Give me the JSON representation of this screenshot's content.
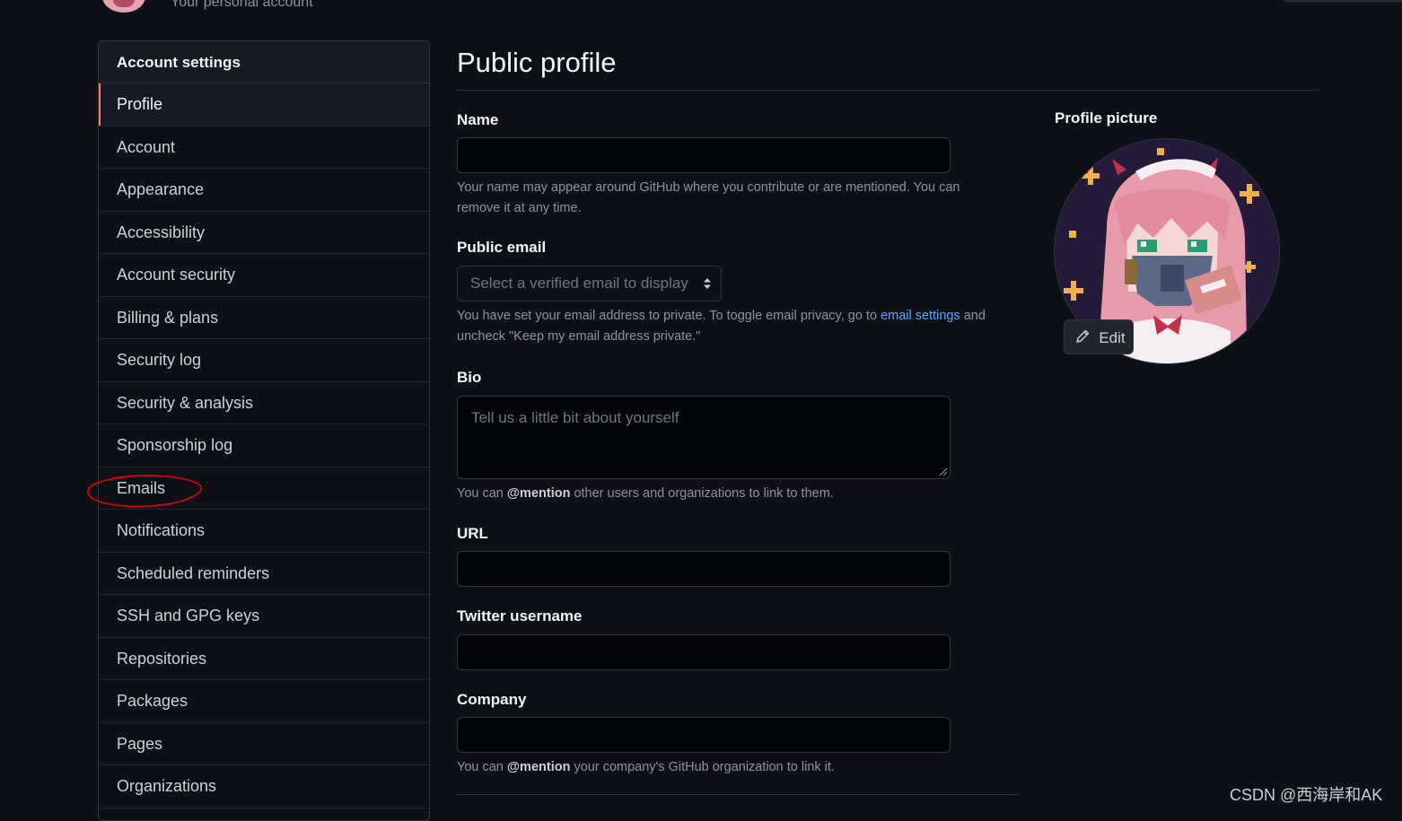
{
  "header": {
    "subtitle": "Your personal account"
  },
  "sidebar": {
    "title": "Account settings",
    "items": [
      {
        "label": "Profile",
        "selected": true
      },
      {
        "label": "Account"
      },
      {
        "label": "Appearance"
      },
      {
        "label": "Accessibility"
      },
      {
        "label": "Account security"
      },
      {
        "label": "Billing & plans"
      },
      {
        "label": "Security log"
      },
      {
        "label": "Security & analysis"
      },
      {
        "label": "Sponsorship log"
      },
      {
        "label": "Emails",
        "annotated": true
      },
      {
        "label": "Notifications"
      },
      {
        "label": "Scheduled reminders"
      },
      {
        "label": "SSH and GPG keys"
      },
      {
        "label": "Repositories"
      },
      {
        "label": "Packages"
      },
      {
        "label": "Pages"
      },
      {
        "label": "Organizations"
      }
    ]
  },
  "main": {
    "title": "Public profile",
    "name": {
      "label": "Name",
      "value": "",
      "note": "Your name may appear around GitHub where you contribute or are mentioned. You can remove it at any time."
    },
    "public_email": {
      "label": "Public email",
      "placeholder": "Select a verified email to display",
      "note_before": "You have set your email address to private. To toggle email privacy, go to ",
      "note_link": "email settings",
      "note_after": " and uncheck \"Keep my email address private.\""
    },
    "bio": {
      "label": "Bio",
      "placeholder": "Tell us a little bit about yourself",
      "note_before": "You can ",
      "note_bold": "@mention",
      "note_after": " other users and organizations to link to them."
    },
    "url": {
      "label": "URL",
      "value": ""
    },
    "twitter": {
      "label": "Twitter username",
      "value": ""
    },
    "company": {
      "label": "Company",
      "value": "",
      "note_before": "You can ",
      "note_bold": "@mention",
      "note_after": " your company's GitHub organization to link it."
    }
  },
  "profile_picture": {
    "label": "Profile picture",
    "edit_label": "Edit"
  },
  "watermark": "CSDN @西海岸和AK",
  "colors": {
    "background": "#0d1117",
    "selected_accent": "#f78166",
    "link": "#58a6ff",
    "annotation": "#e00000"
  }
}
